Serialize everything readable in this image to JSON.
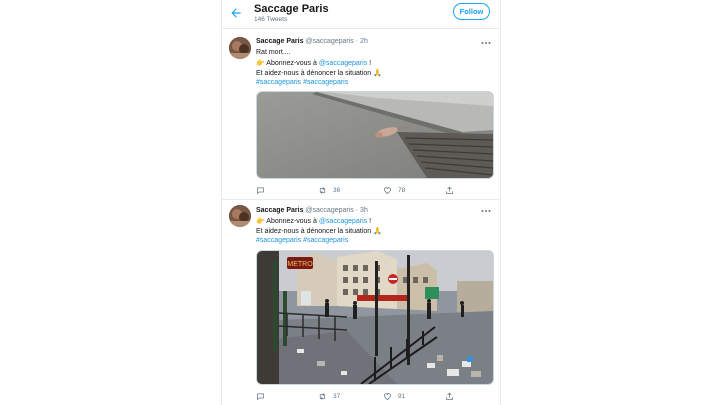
{
  "profile": {
    "name": "Saccage Paris",
    "tweet_count": "146 Tweets",
    "follow_label": "Follow"
  },
  "tweets": [
    {
      "author": "Saccage Paris",
      "handle": "@saccageparis",
      "separator": "·",
      "time": "2h",
      "line1": "Rat mort....",
      "line2_prefix": "Abonnez-vous à ",
      "line2_link": "@saccageparis",
      "line2_suffix": " !",
      "line3": "Et aidez-nous à dénoncer la situation ",
      "hashtags": "#saccageparis #saccageparis",
      "media_icon": "dead-rat-near-drain-photo",
      "stats": {
        "replies": "",
        "retweets": "36",
        "likes": "78"
      }
    },
    {
      "author": "Saccage Paris",
      "handle": "@saccageparis",
      "separator": "·",
      "time": "3h",
      "line2_prefix": "Abonnez-vous à ",
      "line2_link": "@saccageparis",
      "line2_suffix": " !",
      "line3": "Et aidez-nous à dénoncer la situation ",
      "hashtags": "#saccageparis #saccageparis",
      "media_icon": "metro-entrance-street-trash-photo",
      "metro_sign": "METRO",
      "stats": {
        "replies": "",
        "retweets": "37",
        "likes": "91"
      }
    }
  ],
  "icons": {
    "back": "arrow-left-icon",
    "more": "more-dots-icon",
    "reply": "reply-icon",
    "retweet": "retweet-icon",
    "like": "heart-icon",
    "share": "share-icon",
    "point": "pointing-hand-emoji",
    "pray": "praying-hands-emoji"
  },
  "colors": {
    "accent": "#1da1f2",
    "link": "#1b95e0",
    "muted": "#657786",
    "border": "#e6ecf0"
  }
}
